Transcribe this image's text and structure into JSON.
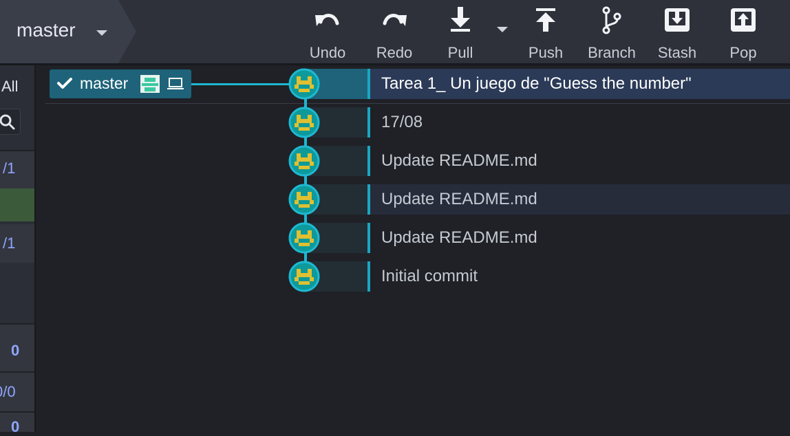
{
  "toolbar": {
    "branch": "master",
    "buttons": [
      {
        "label": "Undo",
        "icon": "undo-icon"
      },
      {
        "label": "Redo",
        "icon": "redo-icon"
      },
      {
        "label": "Pull",
        "icon": "pull-icon"
      },
      {
        "label": "Push",
        "icon": "push-icon"
      },
      {
        "label": "Branch",
        "icon": "branch-icon"
      },
      {
        "label": "Stash",
        "icon": "stash-icon"
      },
      {
        "label": "Pop",
        "icon": "pop-icon"
      }
    ]
  },
  "left_panel": {
    "all_label": "All",
    "count_1": "/1",
    "count_2": "/1",
    "count_3": "0",
    "count_4": "0/0",
    "count_5": "0"
  },
  "graph": {
    "branch_label": "master",
    "commits": [
      {
        "message": "Tarea 1_ Un juego de \"Guess the number\""
      },
      {
        "message": "17/08"
      },
      {
        "message": "Update README.md"
      },
      {
        "message": "Update README.md"
      },
      {
        "message": "Update README.md"
      },
      {
        "message": "Initial commit"
      }
    ]
  },
  "colors": {
    "accent": "#1eb8d2",
    "selected_row": "#2b3a57",
    "branch_label": "#1e6379",
    "avatar_yellow": "#e0c030",
    "avatar_teal": "#0e9a9a"
  }
}
